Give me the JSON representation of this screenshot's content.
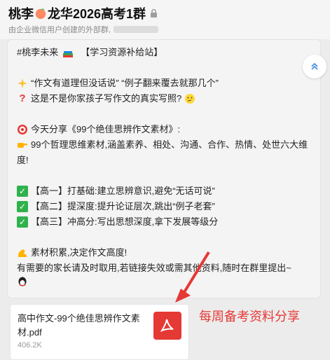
{
  "header": {
    "title_part1": "桃李",
    "title_part2": "龙华2026高考1群",
    "subtitle": "由企业微信用户创建的外部群,"
  },
  "message": {
    "line1": "#桃李未来",
    "line1b": "【学习资源补给站】",
    "line2": "“作文有道理但没话说” “例子翻来覆去就那几个”",
    "line3": "这是不是你家孩子写作文的真实写照?",
    "line4": "今天分享《99个绝佳思辨作文素材》:",
    "line5": "99个哲理思维素材,涵盖素养、相处、沟通、合作、热情、处世六大维度!",
    "line6": "【高一】打基础:建立思辨意识,避免“无话可说”",
    "line7": "【高二】提深度:提升论证层次,跳出“例子老套”",
    "line8": "【高三】冲高分:写出思想深度,拿下发展等级分",
    "line9": "素材积累,决定作文高度!",
    "line10": "有需要的家长请及时取用,若链接失效或需其他资料,随时在群里提出~"
  },
  "file": {
    "name": "高中作文-99个绝佳思辨作文素材.pdf",
    "size": "406.2K",
    "icon": "pdf-icon"
  },
  "annotation": {
    "text": "每周备考资料分享",
    "color": "#e53935"
  }
}
